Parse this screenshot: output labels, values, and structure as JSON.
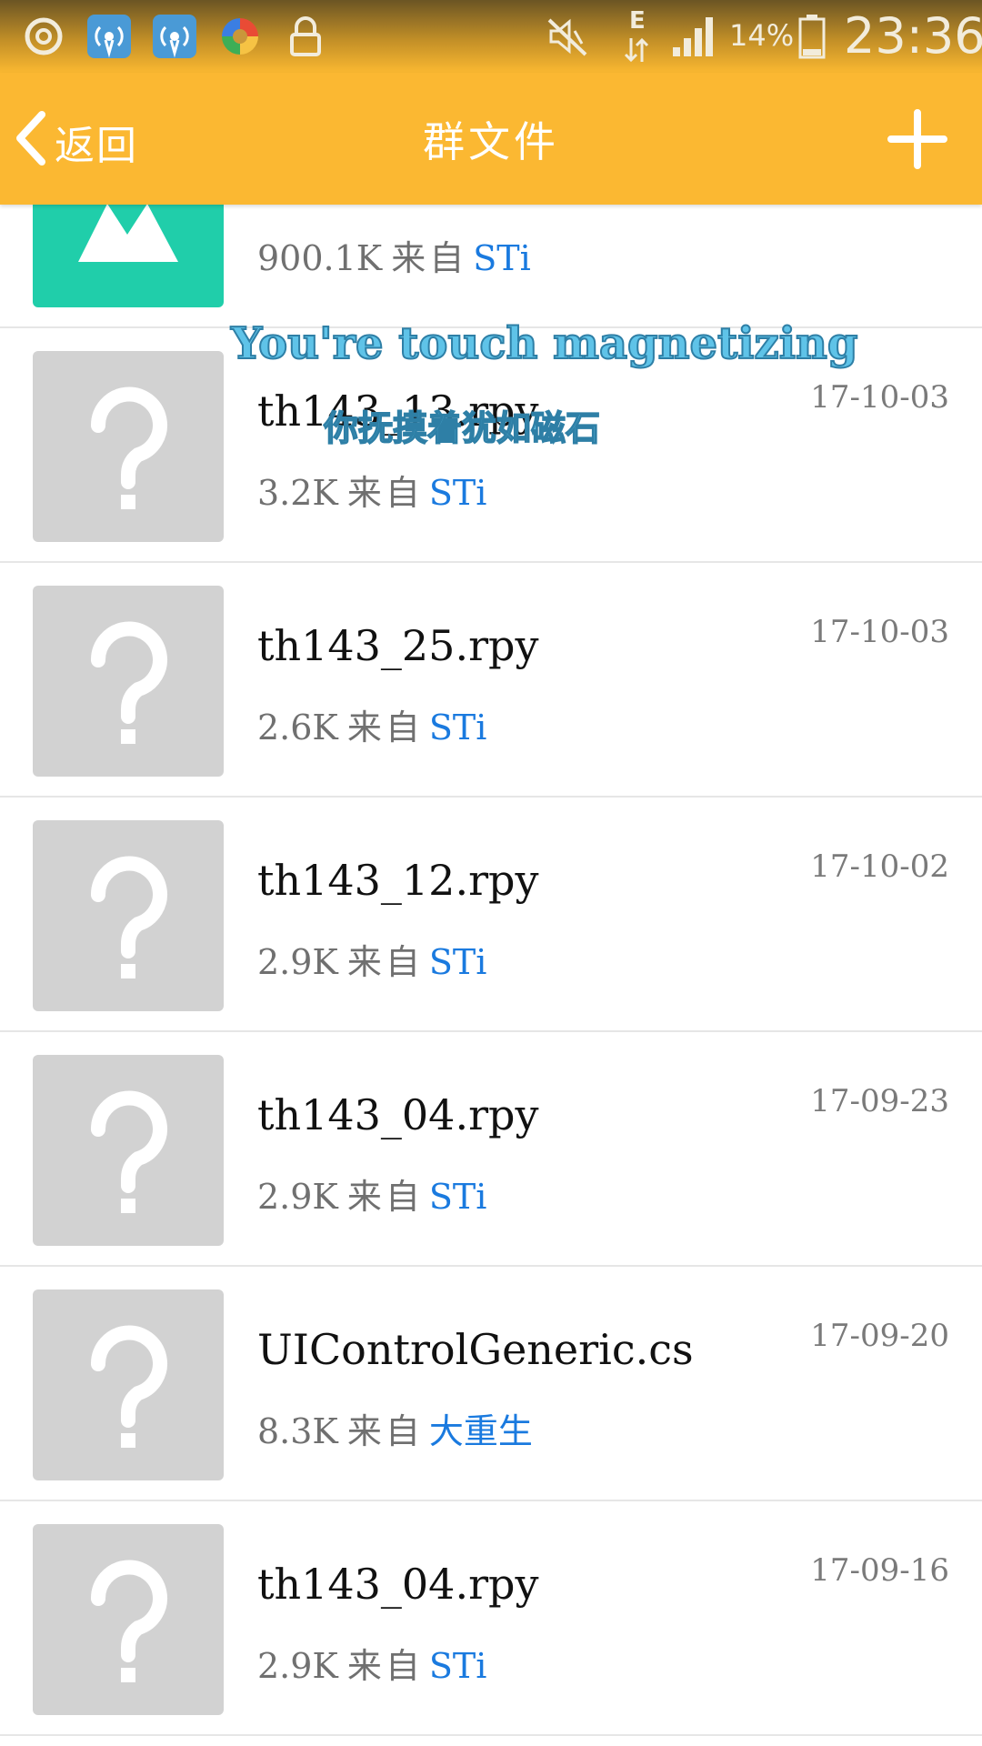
{
  "status_bar": {
    "network_type": "E",
    "battery_percent": "14%",
    "time": "23:36",
    "icons": [
      "netease-music-icon",
      "wifi-hotspot-icon",
      "wifi-hotspot-icon",
      "colorful-app-icon",
      "lock-icon",
      "mute-icon",
      "data-arrows-icon",
      "signal-icon",
      "battery-icon"
    ]
  },
  "header": {
    "back_label": "返回",
    "title": "群文件",
    "add_icon": "plus-icon"
  },
  "files": [
    {
      "name": "",
      "size": "900.1K",
      "from_label": "来自",
      "sender": "STi",
      "date": "",
      "type": "image"
    },
    {
      "name": "th143_13.rpy",
      "size": "3.2K",
      "from_label": "来自",
      "sender": "STi",
      "date": "17-10-03",
      "type": "unknown"
    },
    {
      "name": "th143_25.rpy",
      "size": "2.6K",
      "from_label": "来自",
      "sender": "STi",
      "date": "17-10-03",
      "type": "unknown"
    },
    {
      "name": "th143_12.rpy",
      "size": "2.9K",
      "from_label": "来自",
      "sender": "STi",
      "date": "17-10-02",
      "type": "unknown"
    },
    {
      "name": "th143_04.rpy",
      "size": "2.9K",
      "from_label": "来自",
      "sender": "STi",
      "date": "17-09-23",
      "type": "unknown"
    },
    {
      "name": "UIControlGeneric.cs",
      "size": "8.3K",
      "from_label": "来自",
      "sender": "大重生",
      "date": "17-09-20",
      "type": "unknown"
    },
    {
      "name": "th143_04.rpy",
      "size": "2.9K",
      "from_label": "来自",
      "sender": "STi",
      "date": "17-09-16",
      "type": "unknown"
    }
  ],
  "overlay_caption": {
    "english": "You're touch magnetizing",
    "chinese": "你抚摸着犹如磁石"
  },
  "colors": {
    "header_bg": "#fbb832",
    "sender_link": "#1a7adf",
    "image_thumb": "#20ceaa",
    "unknown_thumb": "#d2d2d2"
  }
}
